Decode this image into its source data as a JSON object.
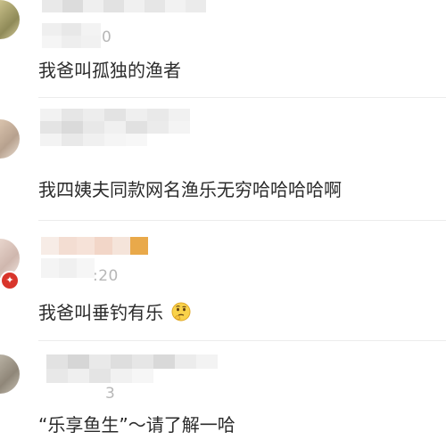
{
  "comments": [
    {
      "timestamp_visible": "0",
      "text": "我爸叫孤独的渔者"
    },
    {
      "timestamp_visible": "",
      "text": "我四姨夫同款网名渔乐无穷哈哈哈哈啊"
    },
    {
      "timestamp_visible": ":20",
      "text": "我爸叫垂钓有乐"
    },
    {
      "timestamp_visible": "3",
      "text": "“乐享鱼生”～请了解一哈"
    }
  ],
  "icons": {
    "emoji": "thinking-face-icon",
    "badge": "verified-badge-icon"
  },
  "colors": {
    "text": "#2b2b2b",
    "timestamp": "#b7b7b7",
    "badge": "#d8352b",
    "divider": "#ececec"
  }
}
